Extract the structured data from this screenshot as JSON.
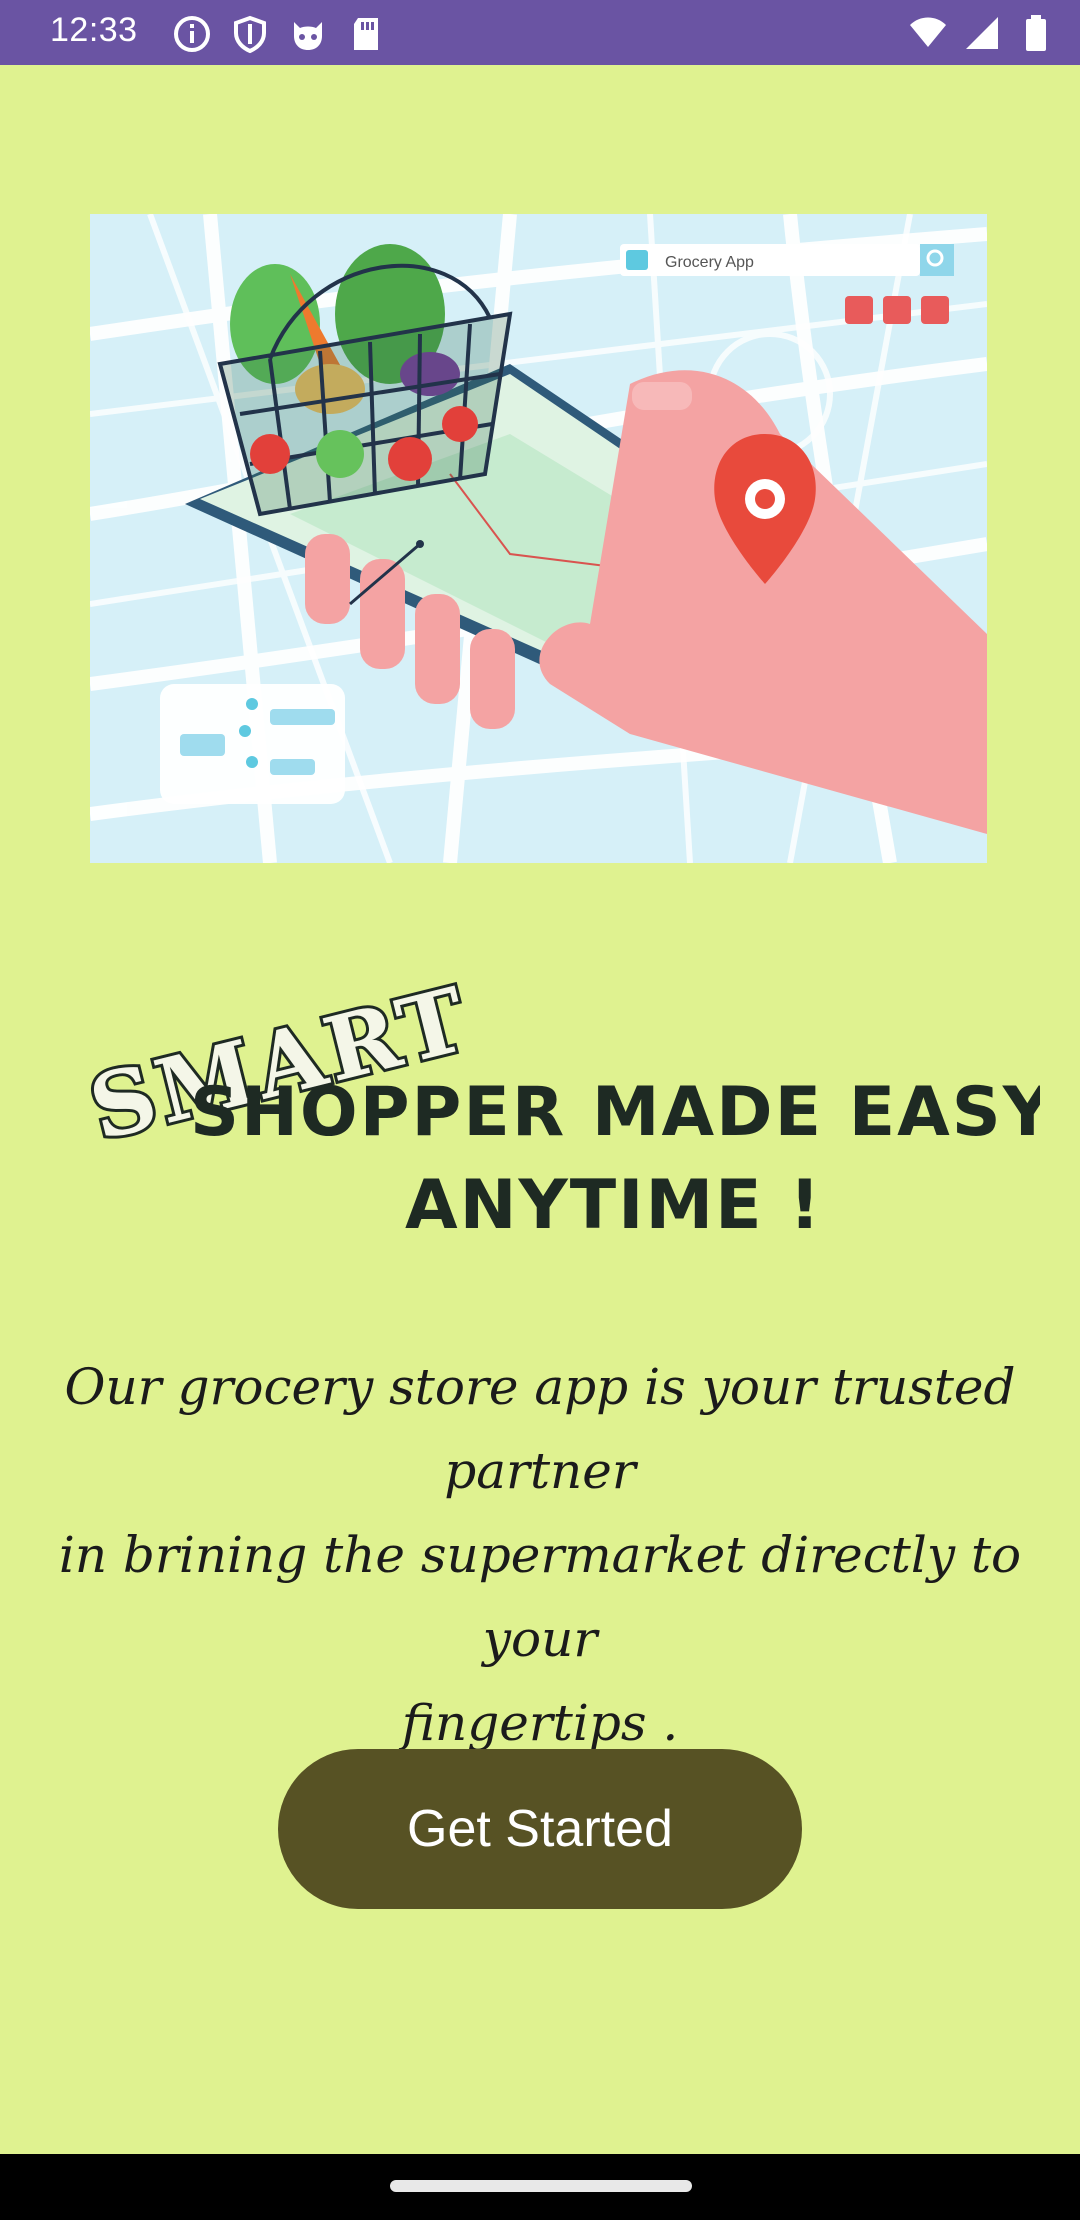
{
  "status_bar": {
    "time": "12:33",
    "icons_left": [
      "info-icon",
      "shield-icon",
      "cat-face-icon",
      "sd-card-icon"
    ],
    "icons_right": [
      "wifi-icon",
      "signal-icon",
      "battery-icon"
    ]
  },
  "hero": {
    "search_label": "Grocery App"
  },
  "headline": {
    "word1": "SMART",
    "line1": "SHOPPER MADE EASY",
    "line2": "ANYTIME !"
  },
  "description": {
    "line1": "Our grocery store app is your trusted partner",
    "line2": "in brining the supermarket directly to your",
    "line3": "fingertips ."
  },
  "button": {
    "label": "Get Started"
  },
  "colors": {
    "background": "#dff290",
    "status_bar": "#6a54a3",
    "button": "#575224",
    "headline": "#1e2a23"
  }
}
